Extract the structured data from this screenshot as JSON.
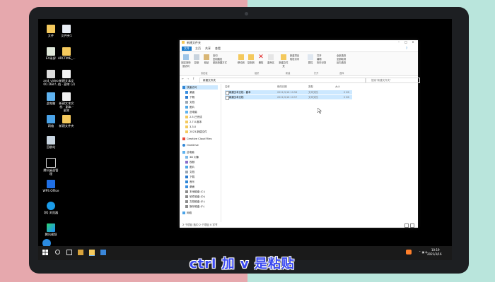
{
  "caption": "ctrl 加 v 是粘贴",
  "desktop": {
    "icons": [
      {
        "label": "文件"
      },
      {
        "label": "文件夹1"
      },
      {
        "label": "EV录屏"
      },
      {
        "label": "ARCTIME_..."
      },
      {
        "label": "and_video 00.168.f..."
      },
      {
        "label": "新建文本文档 - 副本 (2)"
      },
      {
        "label": "此电脑"
      },
      {
        "label": "新建文本文档 - 副本 - 副本"
      },
      {
        "label": "网络"
      },
      {
        "label": "新建文件夹"
      },
      {
        "label": "回收站"
      },
      {
        "label": "腾讯桌面管理"
      },
      {
        "label": "WPS Office"
      },
      {
        "label": "QQ 浏览器"
      },
      {
        "label": "腾讯视频"
      }
    ]
  },
  "explorer": {
    "title": "新建文件夹",
    "tabs": [
      {
        "label": "文件"
      },
      {
        "label": "主页"
      },
      {
        "label": "共享"
      },
      {
        "label": "查看"
      }
    ],
    "ribbon": {
      "pin_label": "固定到快速访问",
      "copy_label": "复制",
      "paste_label": "粘贴",
      "cut_label": "剪切",
      "copy_path_label": "复制路径",
      "paste_shortcut_label": "粘贴快捷方式",
      "move_to_label": "移动到",
      "copy_to_label": "复制到",
      "delete_label": "删除",
      "rename_label": "重命名",
      "new_folder_label": "新建文件夹",
      "new_item_label": "新建项目",
      "easy_access_label": "轻松访问",
      "properties_label": "属性",
      "open_label": "打开",
      "edit_label": "编辑",
      "history_label": "历史记录",
      "select_all_label": "全部选择",
      "select_none_label": "全部取消",
      "invert_label": "反向选择",
      "group_clipboard": "剪贴板",
      "group_organize": "组织",
      "group_new": "新建",
      "group_open": "打开",
      "group_select": "选择"
    },
    "address": "新建文件夹",
    "search_placeholder": "搜索\"新建文件夹\"",
    "nav": [
      {
        "label": "快速访问"
      },
      {
        "label": "桌面"
      },
      {
        "label": "下载"
      },
      {
        "label": "文档"
      },
      {
        "label": "图片"
      },
      {
        "label": "此电脑"
      },
      {
        "label": "2.5.已完成"
      },
      {
        "label": "2.7.0.副本"
      },
      {
        "label": "3.3.0"
      },
      {
        "label": "2023.新建文件"
      },
      {
        "label": "Creative Cloud Files"
      },
      {
        "label": "OneDrive"
      },
      {
        "label": "此电脑"
      },
      {
        "label": "3D 对象"
      },
      {
        "label": "视频"
      },
      {
        "label": "图片"
      },
      {
        "label": "文档"
      },
      {
        "label": "下载"
      },
      {
        "label": "音乐"
      },
      {
        "label": "桌面"
      },
      {
        "label": "本地磁盘 (C:)"
      },
      {
        "label": "软件磁盘 (D:)"
      },
      {
        "label": "文档磁盘 (E:)"
      },
      {
        "label": "娱乐磁盘 (F:)"
      },
      {
        "label": "网络"
      }
    ],
    "columns": {
      "name": "名称",
      "date": "修改日期",
      "type": "类型",
      "size": "大小"
    },
    "files": [
      {
        "name": "新建文本文档 - 副本",
        "date": "2021/3/16 10:56",
        "type": "文本文档",
        "size": "0 KB"
      },
      {
        "name": "新建文本文档",
        "date": "2021/3/16 10:57",
        "type": "文本文档",
        "size": "0 KB"
      }
    ],
    "status": "2 个项目   选中 2 个项目   0 字节"
  },
  "taskbar": {
    "time": "10:19",
    "date": "2021/3/16"
  }
}
